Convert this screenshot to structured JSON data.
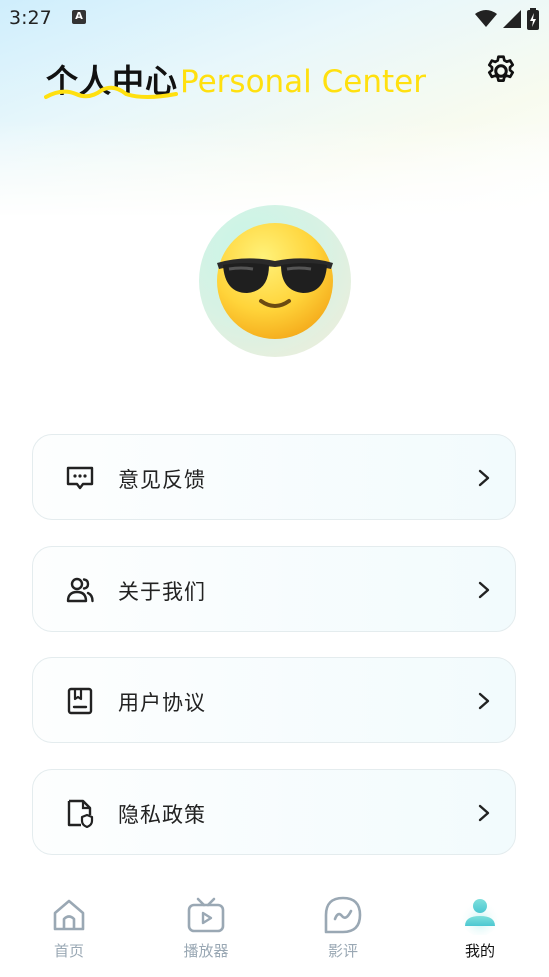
{
  "status_bar": {
    "time": "3:27",
    "notification_letter": "A"
  },
  "header": {
    "title_cn": "个人中心",
    "title_en": "Personal Center"
  },
  "menu": [
    {
      "label": "意见反馈",
      "icon": "message-icon"
    },
    {
      "label": "关于我们",
      "icon": "users-icon"
    },
    {
      "label": "用户协议",
      "icon": "agreement-icon"
    },
    {
      "label": "隐私政策",
      "icon": "privacy-icon"
    }
  ],
  "tabs": [
    {
      "label": "首页",
      "icon": "home-icon",
      "active": false
    },
    {
      "label": "播放器",
      "icon": "tv-icon",
      "active": false
    },
    {
      "label": "影评",
      "icon": "review-icon",
      "active": false
    },
    {
      "label": "我的",
      "icon": "profile-icon",
      "active": true
    }
  ],
  "colors": {
    "accent_yellow": "#ffe00f",
    "tab_inactive": "#9aa8b4",
    "tab_active": "#111111",
    "active_icon": "#5ed3d8"
  }
}
